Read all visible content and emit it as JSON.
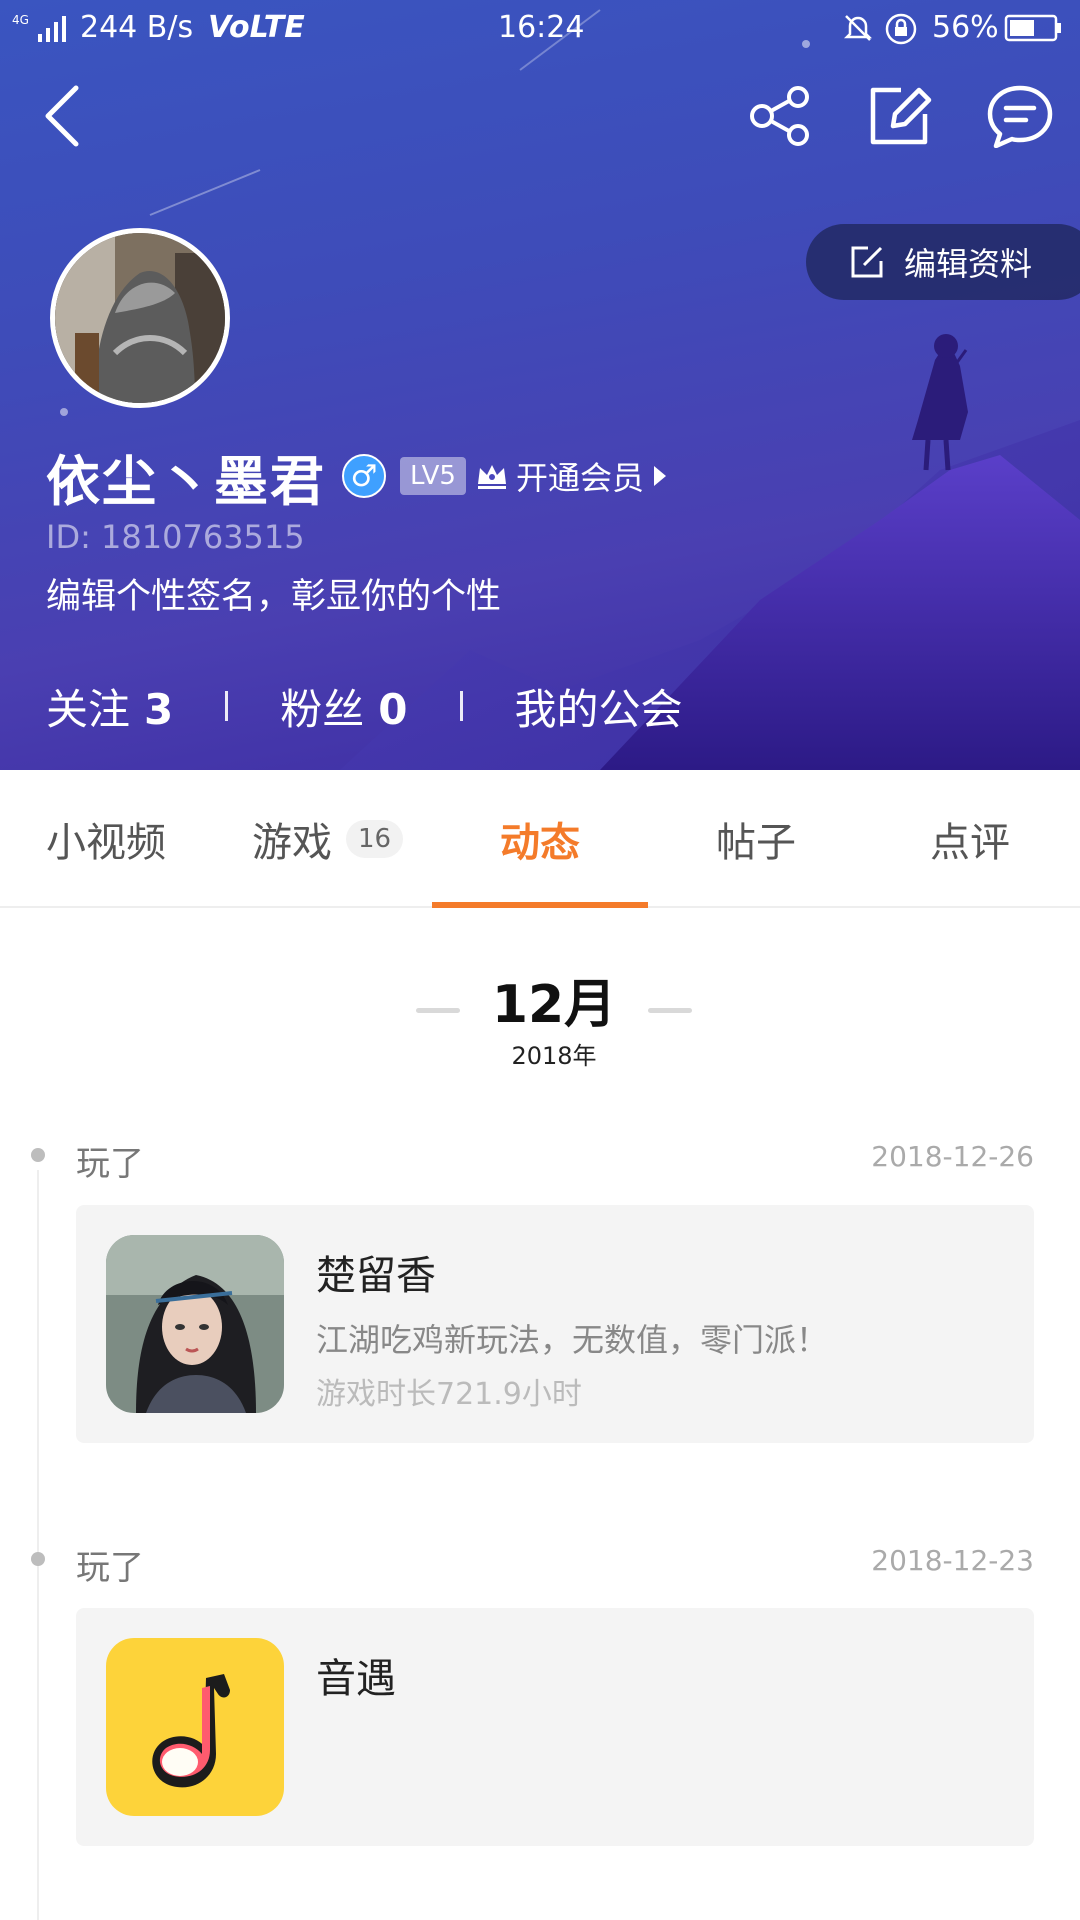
{
  "status_bar": {
    "signal": "4G",
    "speed": "244 B/s",
    "volte": "VoLTE",
    "time": "16:24",
    "battery_percent": "56%",
    "icons": [
      "mute-icon",
      "rotation-lock-icon",
      "battery-icon"
    ]
  },
  "top_bar": {
    "actions": [
      "back-icon",
      "share-icon",
      "edit-post-icon",
      "message-icon"
    ]
  },
  "profile": {
    "edit_label": "编辑资料",
    "name": "依尘丶墨君",
    "gender_symbol": "♂",
    "level": "LV5",
    "vip_label": "开通会员",
    "id": "ID: 1810763515",
    "signature": "编辑个性签名，彰显你的个性",
    "following_label": "关注",
    "following_count": "3",
    "fans_label": "粉丝",
    "fans_count": "0",
    "guild_label": "我的公会"
  },
  "tabs": [
    {
      "label": "小视频"
    },
    {
      "label": "游戏",
      "badge": "16"
    },
    {
      "label": "动态",
      "active": true
    },
    {
      "label": "帖子"
    },
    {
      "label": "点评"
    }
  ],
  "colors": {
    "accent": "#f47b2a",
    "header_blue": "#3e4cb9"
  },
  "feed": {
    "month": "12月",
    "year": "2018年",
    "items": [
      {
        "action": "玩了",
        "date": "2018-12-26",
        "game": "楚留香",
        "desc": "江湖吃鸡新玩法，无数值，零门派！",
        "playtime": "游戏时长721.9小时"
      },
      {
        "action": "玩了",
        "date": "2018-12-23",
        "game": "音遇"
      }
    ]
  }
}
